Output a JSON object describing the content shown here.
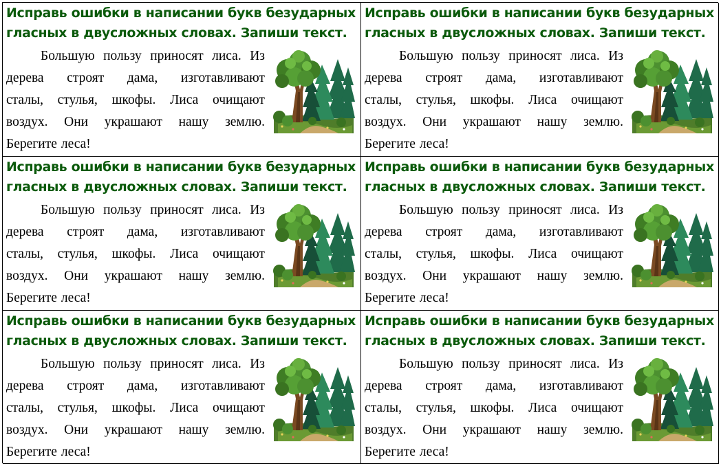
{
  "cards": [
    {
      "title": "Исправь ошибки в написании букв безударных\nгласных в двусложных словах. Запиши текст.",
      "lines": [
        [
          "Большую",
          "пользу",
          "приносят",
          "лиса.",
          "Из"
        ],
        [
          "дерева",
          "строят",
          "дама,",
          "изготавливают"
        ],
        [
          "сталы,",
          "стулья,",
          "шкофы.",
          "Лиса",
          "очищают"
        ],
        [
          "воздух.",
          "Они",
          "украшают",
          "нашу",
          "землю."
        ],
        [
          "Берегите",
          "леса!"
        ]
      ],
      "image": "forest-illustration"
    },
    {
      "title": "Исправь ошибки в написании букв безударных\nгласных в двусложных словах. Запиши текст.",
      "lines": [
        [
          "Большую",
          "пользу",
          "приносят",
          "лиса.",
          "Из"
        ],
        [
          "дерева",
          "строят",
          "дама,",
          "изготавливают"
        ],
        [
          "сталы,",
          "стулья,",
          "шкофы.",
          "Лиса",
          "очищают"
        ],
        [
          "воздух.",
          "Они",
          "украшают",
          "нашу",
          "землю."
        ],
        [
          "Берегите",
          "леса!"
        ]
      ],
      "image": "forest-illustration"
    },
    {
      "title": "Исправь ошибки в написании букв безударных\nгласных в двусложных словах. Запиши текст.",
      "lines": [
        [
          "Большую",
          "пользу",
          "приносят",
          "лиса.",
          "Из"
        ],
        [
          "дерева",
          "строят",
          "дама,",
          "изготавливают"
        ],
        [
          "сталы,",
          "стулья,",
          "шкофы.",
          "Лиса",
          "очищают"
        ],
        [
          "воздух.",
          "Они",
          "украшают",
          "нашу",
          "землю."
        ],
        [
          "Берегите",
          "леса!"
        ]
      ],
      "image": "forest-illustration"
    },
    {
      "title": "Исправь ошибки в написании букв безударных\nгласных в двусложных словах. Запиши текст.",
      "lines": [
        [
          "Большую",
          "пользу",
          "приносят",
          "лиса.",
          "Из"
        ],
        [
          "дерева",
          "строят",
          "дама,",
          "изготавливают"
        ],
        [
          "сталы,",
          "стулья,",
          "шкофы.",
          "Лиса",
          "очищают"
        ],
        [
          "воздух.",
          "Они",
          "украшают",
          "нашу",
          "землю."
        ],
        [
          "Берегите",
          "леса!"
        ]
      ],
      "image": "forest-illustration"
    },
    {
      "title": "Исправь ошибки в написании букв безударных\nгласных в двусложных словах. Запиши текст.",
      "lines": [
        [
          "Большую",
          "пользу",
          "приносят",
          "лиса.",
          "Из"
        ],
        [
          "дерева",
          "строят",
          "дама,",
          "изготавливают"
        ],
        [
          "сталы,",
          "стулья,",
          "шкофы.",
          "Лиса",
          "очищают"
        ],
        [
          "воздух.",
          "Они",
          "украшают",
          "нашу",
          "землю."
        ],
        [
          "Берегите",
          "леса!"
        ]
      ],
      "image": "forest-illustration"
    },
    {
      "title": "Исправь ошибки в написании букв безударных\nгласных в двусложных словах. Запиши текст.",
      "lines": [
        [
          "Большую",
          "пользу",
          "приносят",
          "лиса.",
          "Из"
        ],
        [
          "дерева",
          "строят",
          "дама,",
          "изготавливают"
        ],
        [
          "сталы,",
          "стулья,",
          "шкофы.",
          "Лиса",
          "очищают"
        ],
        [
          "воздух.",
          "Они",
          "украшают",
          "нашу",
          "землю."
        ],
        [
          "Берегите",
          "леса!"
        ]
      ],
      "image": "forest-illustration"
    }
  ],
  "colors": {
    "title": "#0b5a0b",
    "text": "#000000",
    "border": "#000000"
  }
}
